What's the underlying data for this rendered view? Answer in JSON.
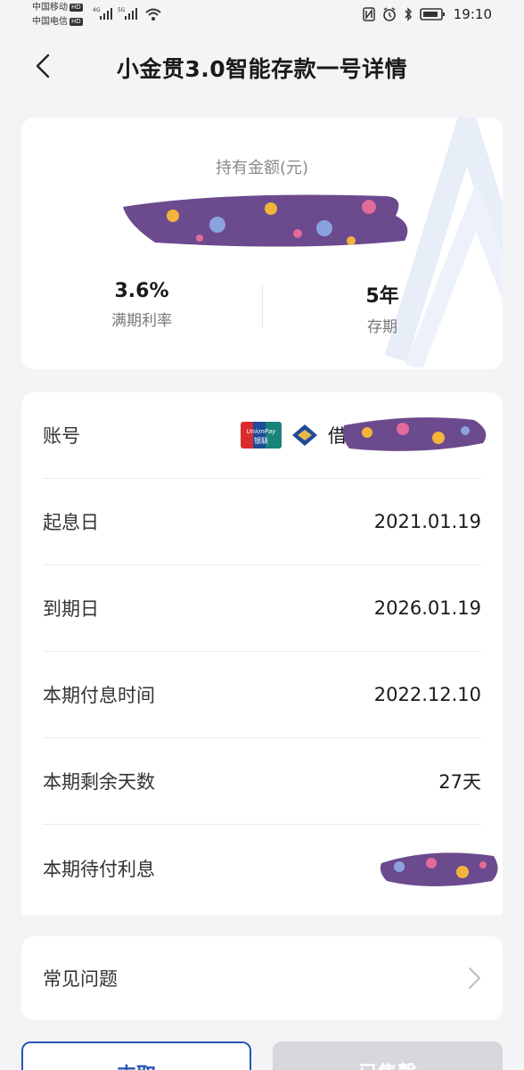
{
  "status_bar": {
    "carrier1": "中国移动",
    "carrier2": "中国电信",
    "hd": "HD",
    "net1": "4G",
    "net2": "5G",
    "time": "19:10"
  },
  "header": {
    "title": "小金贯3.0智能存款一号详情"
  },
  "summary": {
    "holding_label": "持有金额(元)",
    "rate_value": "3.6%",
    "rate_label": "满期利率",
    "term_value": "5年",
    "term_label": "存期"
  },
  "details": {
    "rows": [
      {
        "label": "账号",
        "value": "借记"
      },
      {
        "label": "起息日",
        "value": "2021.01.19"
      },
      {
        "label": "到期日",
        "value": "2026.01.19"
      },
      {
        "label": "本期付息时间",
        "value": "2022.12.10"
      },
      {
        "label": "本期剩余天数",
        "value": "27天"
      },
      {
        "label": "本期待付利息",
        "value": ""
      }
    ],
    "unionpay_top": "UnionPay",
    "unionpay_bottom": "银联"
  },
  "faq": {
    "label": "常见问题"
  },
  "buttons": {
    "withdraw": "支取",
    "transfer": "已售罄"
  },
  "colors": {
    "accent": "#2458b6",
    "background": "#f4f4f6",
    "redaction": "#6b4a8e"
  }
}
